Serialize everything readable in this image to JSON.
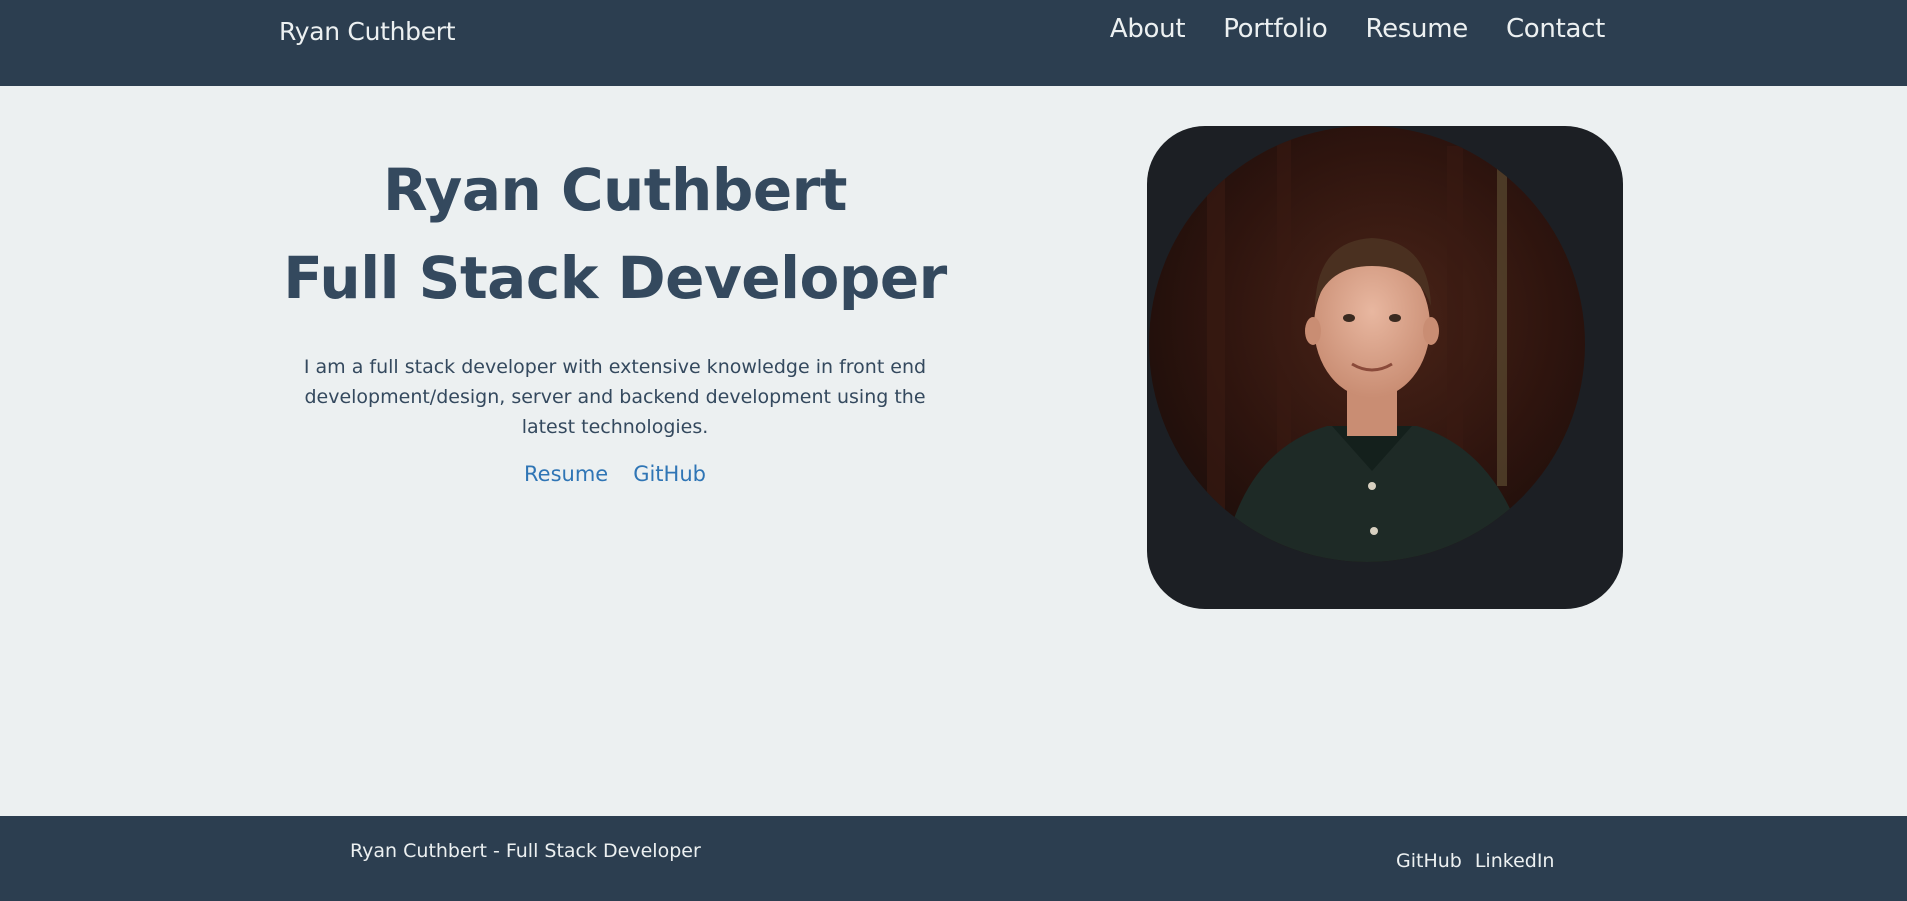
{
  "navbar": {
    "brand": "Ryan Cuthbert",
    "links": [
      "About",
      "Portfolio",
      "Resume",
      "Contact"
    ]
  },
  "hero": {
    "name": "Ryan Cuthbert",
    "role": "Full Stack Developer",
    "description": "I am a full stack developer with extensive knowledge in front end development/design, server and backend development using the latest technologies.",
    "links": [
      "Resume",
      "GitHub"
    ]
  },
  "footer": {
    "text": "Ryan Cuthbert - Full Stack Developer",
    "links": [
      "GitHub",
      "LinkedIn"
    ]
  },
  "colors": {
    "navbar_bg": "#2c3e50",
    "page_bg": "#ecf0f1",
    "heading": "#34495e",
    "link": "#2f75b5"
  }
}
